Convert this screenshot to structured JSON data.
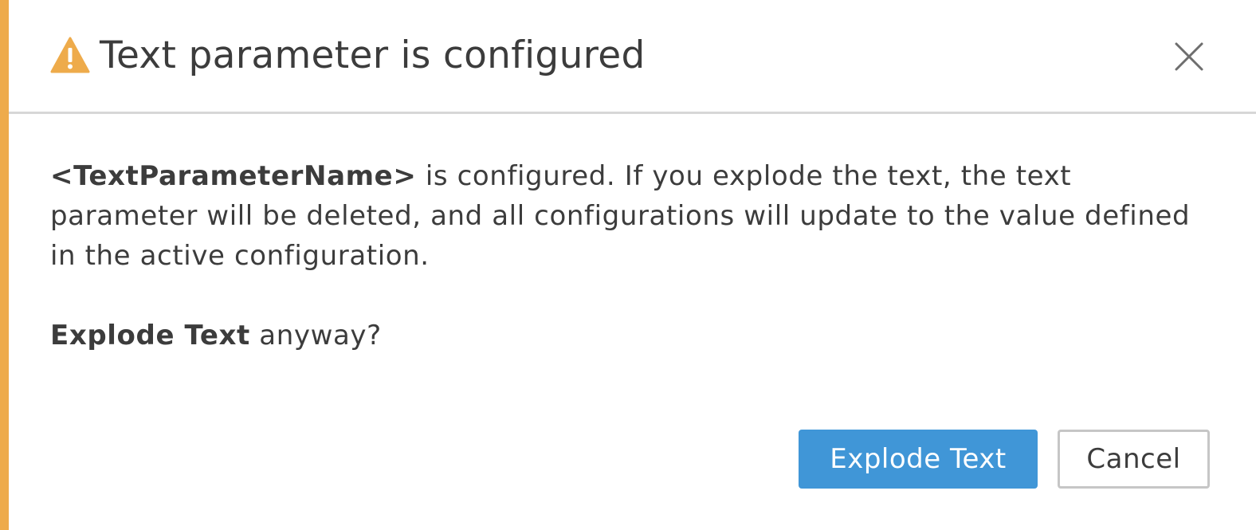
{
  "dialog": {
    "title": "Text parameter is configured",
    "title_icon": "warning-triangle-icon",
    "close_icon": "close-icon",
    "accent_color": "#eeab4b",
    "message": {
      "param_name": "<TextParameterName>",
      "text": " is configured. If you explode the text, the text parameter will be deleted, and all configurations will update to the value defined in the active configuration."
    },
    "question": {
      "action": "Explode Text",
      "suffix": " anyway?"
    },
    "buttons": {
      "primary_label": "Explode Text",
      "primary_color": "#4096d7",
      "secondary_label": "Cancel"
    }
  }
}
